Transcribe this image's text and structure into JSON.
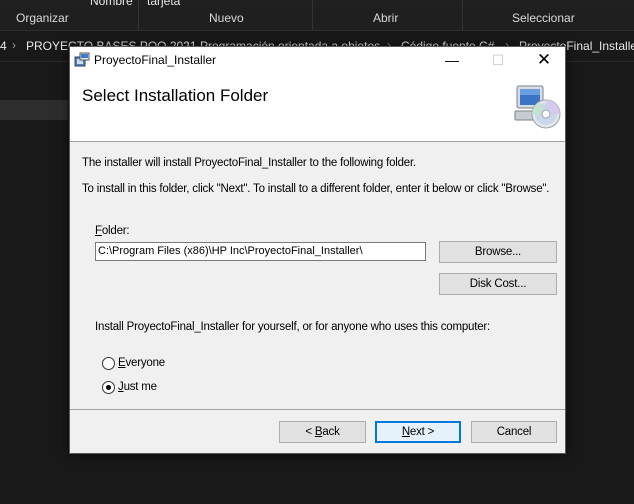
{
  "explorer": {
    "top_fragment_1": "Nombre",
    "top_fragment_2": "tarjeta",
    "ribbon_groups": [
      "Organizar",
      "Nuevo",
      "Abrir",
      "Seleccionar"
    ],
    "breadcrumbs": [
      "4",
      "PROYECTO BASES POO 2021",
      "Programación orientada a objetos",
      "Código fuente C#",
      "ProyectoFinal_Installer"
    ]
  },
  "dialog": {
    "title": "ProyectoFinal_Installer",
    "window_controls": {
      "minimize": "—",
      "maximize": "☐",
      "close": "✕"
    },
    "banner_title": "Select Installation Folder",
    "intro_text": "The installer will install ProyectoFinal_Installer to the following folder.",
    "instructions_text": "To install in this folder, click \"Next\". To install to a different folder, enter it below or click \"Browse\".",
    "folder_label_accel": "F",
    "folder_label_rest": "older:",
    "folder_value": "C:\\Program Files (x86)\\HP Inc\\ProyectoFinal_Installer\\",
    "browse_button": "Browse...",
    "disk_cost_button": "Disk Cost...",
    "install_for_text": "Install ProyectoFinal_Installer for yourself, or for anyone who uses this computer:",
    "options": [
      {
        "accel": "E",
        "rest": "veryone",
        "selected": false
      },
      {
        "accel": "J",
        "rest": "ust me",
        "selected": true
      }
    ],
    "back_button": {
      "prefix": "< ",
      "accel": "B",
      "rest": "ack"
    },
    "next_button": {
      "accel": "N",
      "rest": "ext >"
    },
    "cancel_button": "Cancel",
    "icons": {
      "app": "installer-icon",
      "banner": "computer-cd-icon"
    }
  }
}
